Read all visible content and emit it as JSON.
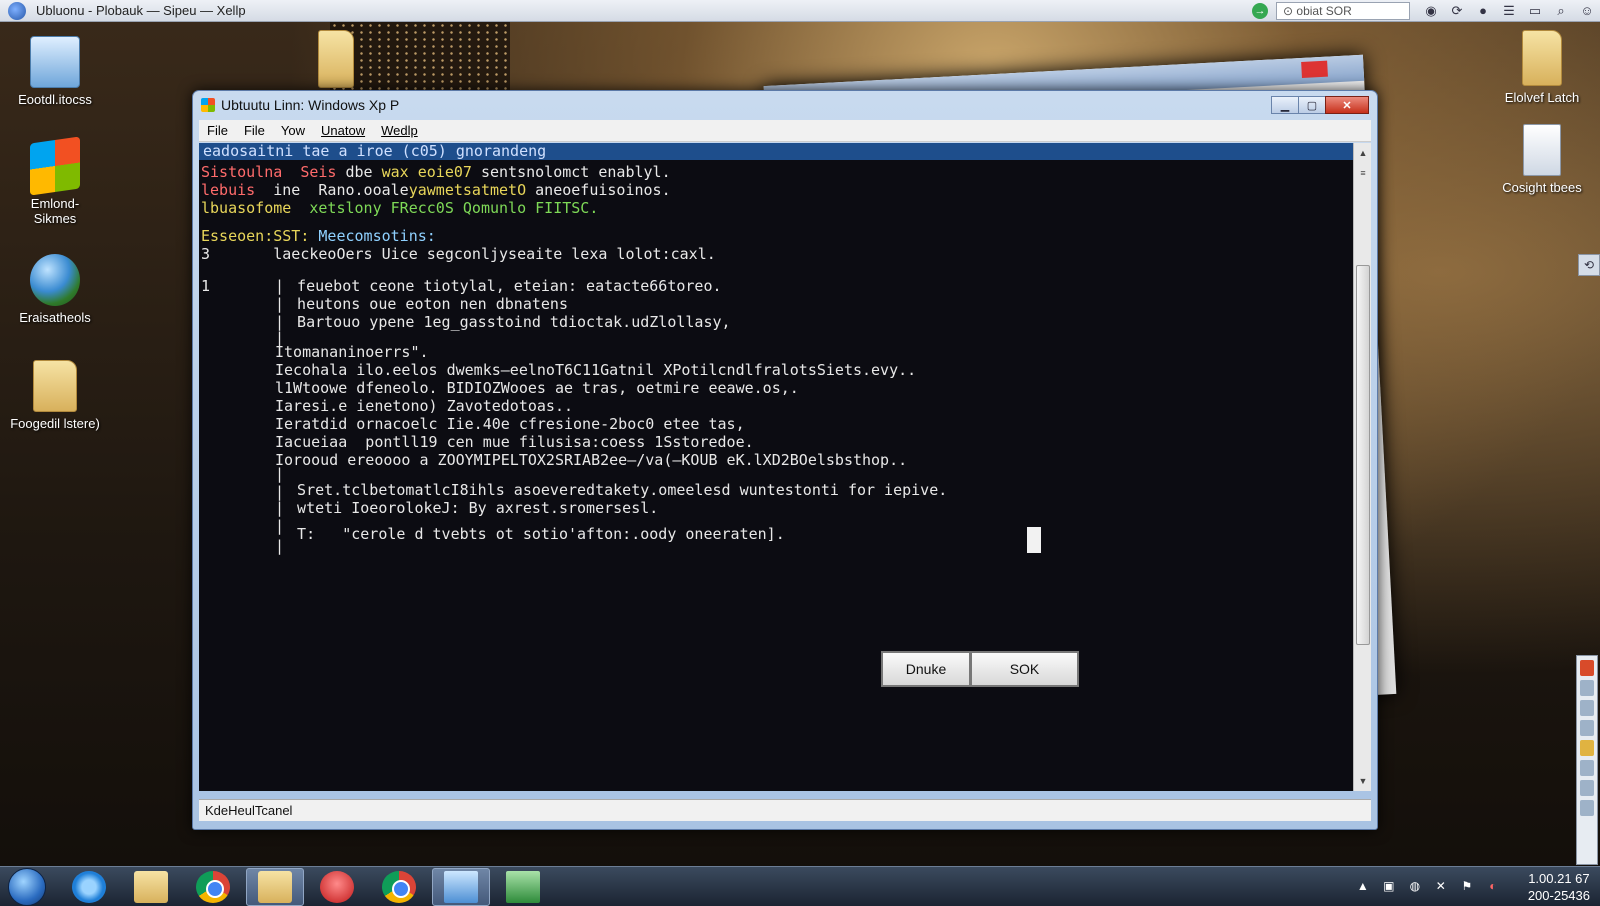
{
  "topbar": {
    "title": "Ubluonu  -  Plobauk  —  Sipeu  —  Xellp",
    "address": "⊙ obiat SOR"
  },
  "desktop": {
    "icons": [
      {
        "label": "Eootdl.itocss"
      },
      {
        "label": "Emlond-\nSikmes"
      },
      {
        "label": "Eraisatheols"
      },
      {
        "label": "Foogedil lstere)"
      },
      {
        "label": "Elolvef Latch"
      },
      {
        "label": "Cosight tbees"
      }
    ]
  },
  "window": {
    "title": "Ubtuutu Linn: Windows Xp P",
    "menu": [
      "File",
      "File",
      "Yow",
      "Unatow",
      "Wedlp"
    ],
    "status": "KdeHeulTcanel",
    "buttons": {
      "left": "Dnuke",
      "right": "SOK"
    }
  },
  "terminal": {
    "header": "eadosaitni tae a iroe (c05) gnorandeng",
    "lines": [
      {
        "a": "Sistoulna  ",
        "b": "Seis",
        "c": " dbe ",
        "d": "wax eoie07",
        "e": " sentsnolomct enablyl."
      },
      {
        "a": "lebuis  ",
        "b": "ine",
        "c": "  Rano.ooale",
        "d": "yawmetsatmetO",
        "e": " aneoefuisoinos."
      },
      {
        "a": "lbuasofome  ",
        "b": "",
        "c": "",
        "d": "xetslony FRecc0S Qomunlo FIITSC.",
        "e": ""
      }
    ],
    "section": {
      "a": "Esseoen:SST: ",
      "b": "Meecomsotins:"
    },
    "line_a": "3       laeckeoOers Uice segconljyseaite lexa lolot:caxl.",
    "line_b_num": "1",
    "block1": [
      "  feuebot ceone tiotylal, eteian: eatacte66toreo.",
      "  heutons oue eoton nen dbnatens",
      "  Bartouo ypene 1eg_gasstoind tdioctak.udZlollasy,"
    ],
    "itoman": "Itomananinoerrs\".",
    "block2": [
      "Iecohala ilo.eelos dwemks—eelnoT6C11Gatnil XPotilcndlfralotsSiets.evy..",
      "l1Wtoowe dfeneolo. BIDIOZWooes ae tras, oetmire eeawe.os,.",
      "Iaresi.e ienetono) Zavotedotoas..",
      "Ieratdid ornacoelc Iie.40e cfresione-2boc0 etee tas,",
      "Iacueiaa  pontll19 cen mue filusisa:coess 1Sstoredoe.",
      "Iorooud ereoooo a ZOOYMIPELTOX2SRIAB2ee—/va(—KOUB eK.lXD2BOelsbsthop.."
    ],
    "block3": [
      "  Sret.tclbetomatlcI8ihls asoeveredtakety.omeelesd wuntestonti for iepive.",
      "  wteti IoeorolokeJ: By axrest.sromersesl."
    ],
    "quote_prefix": "  T:",
    "quote": "\"cerole d tvebts ot sotio'afton:.oody oneeraten].",
    "bars": [
      "|",
      "|",
      "|",
      "|",
      "|",
      "|",
      "|",
      "|",
      "|"
    ]
  },
  "taskbar": {
    "clock_time": "1.00.21 67",
    "clock_date": "200-25436"
  }
}
